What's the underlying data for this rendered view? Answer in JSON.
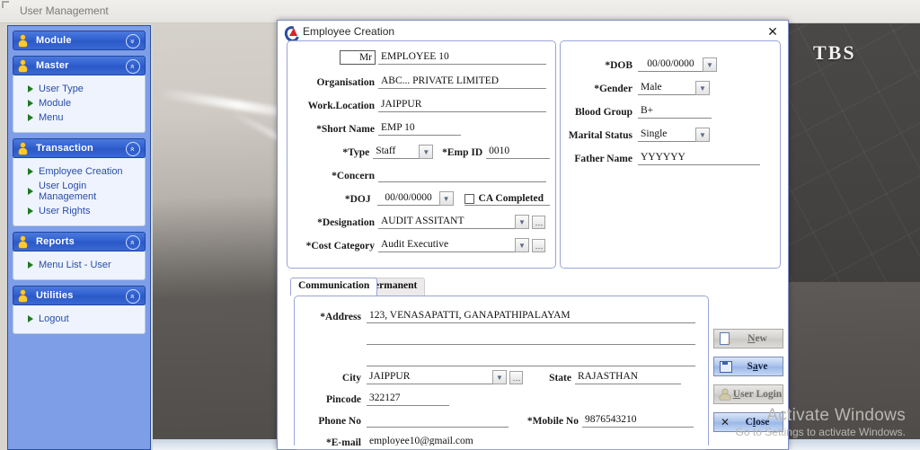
{
  "app": {
    "title": "User Management"
  },
  "background": {
    "logo_text": "TBS"
  },
  "watermark": {
    "line1": "Activate Windows",
    "line2": "Go to Settings to activate Windows."
  },
  "sidebar": {
    "panels": [
      {
        "title": "Module",
        "icon": "person-icon",
        "chevron": "chevron-down-icon",
        "chevron_glyph": "»",
        "expanded": false,
        "items": []
      },
      {
        "title": "Master",
        "icon": "person-icon",
        "chevron": "chevron-up-icon",
        "chevron_glyph": "«",
        "expanded": true,
        "items": [
          "User Type",
          "Module",
          "Menu"
        ]
      },
      {
        "title": "Transaction",
        "icon": "person-icon",
        "chevron": "chevron-up-icon",
        "chevron_glyph": "«",
        "expanded": true,
        "items": [
          "Employee Creation",
          "User Login Management",
          "User Rights"
        ]
      },
      {
        "title": "Reports",
        "icon": "person-icon",
        "chevron": "chevron-up-icon",
        "chevron_glyph": "«",
        "expanded": true,
        "items": [
          "Menu List - User"
        ]
      },
      {
        "title": "Utilities",
        "icon": "person-icon",
        "chevron": "chevron-up-icon",
        "chevron_glyph": "«",
        "expanded": true,
        "items": [
          "Logout"
        ]
      }
    ]
  },
  "dialog": {
    "title": "Employee Creation",
    "app_icon": "employee-creation-app-icon",
    "close_glyph": "✕",
    "personal": {
      "salutation_label": "Mr",
      "name_value": "EMPLOYEE 10",
      "organisation_label": "Organisation",
      "organisation_value": "ABC... PRIVATE LIMITED",
      "work_location_label": "Work.Location",
      "work_location_value": "JAIPPUR",
      "short_name_label": "*Short Name",
      "short_name_value": "EMP 10",
      "type_label": "*Type",
      "type_value": "Staff",
      "emp_id_label": "*Emp ID",
      "emp_id_value": "0010",
      "concern_label": "*Concern",
      "concern_value": "",
      "doj_label": "*DOJ",
      "doj_value": "00/00/0000",
      "ca_completed_label": "CA Completed",
      "ca_completed_checked": false,
      "designation_label": "*Designation",
      "designation_value": "AUDIT ASSITANT",
      "cost_category_label": "*Cost Category",
      "cost_category_value": "Audit Executive"
    },
    "bio": {
      "dob_label": "*DOB",
      "dob_value": "00/00/0000",
      "gender_label": "*Gender",
      "gender_value": "Male",
      "blood_group_label": "Blood Group",
      "blood_group_value": "B+",
      "marital_status_label": "Marital Status",
      "marital_status_value": "Single",
      "father_name_label": "Father Name",
      "father_name_value": "YYYYYY"
    },
    "tabs": [
      {
        "label": "Communication",
        "active": true
      },
      {
        "label": "Permanent",
        "active": false
      }
    ],
    "address": {
      "address_label": "*Address",
      "address_line1": "123, VENASAPATTI, GANAPATHIPALAYAM",
      "address_line2": "",
      "address_line3": "",
      "city_label": "City",
      "city_value": "JAIPPUR",
      "state_label": "State",
      "state_value": "RAJASTHAN",
      "pincode_label": "Pincode",
      "pincode_value": "322127",
      "phone_label": "Phone No",
      "phone_value": "",
      "mobile_label": "*Mobile No",
      "mobile_value": "9876543210",
      "email_label": "*E-mail",
      "email_value": "employee10@gmail.com"
    }
  },
  "actions": [
    {
      "label": "New",
      "accel": "N",
      "icon": "new-document-icon",
      "state": "disabled"
    },
    {
      "label": "Save",
      "accel": "a",
      "icon": "floppy-disk-icon",
      "state": "enabled"
    },
    {
      "label": "User Login",
      "accel": "U",
      "icon": "user-icon",
      "state": "disabled"
    },
    {
      "label": "Close",
      "accel": "l",
      "icon": "close-x-icon",
      "state": "enabled"
    }
  ],
  "colors": {
    "panel_header_blue": "#2f5fcf",
    "sidebar_bg": "#7e9ee8",
    "group_border": "#9aa4d8",
    "arrow_green": "#1e7a1e",
    "person_icon_yellow": "#ffc930"
  }
}
